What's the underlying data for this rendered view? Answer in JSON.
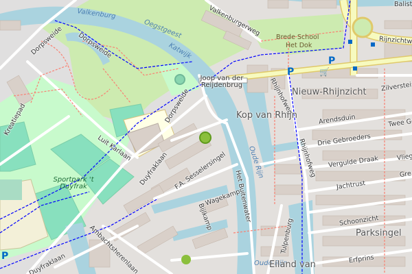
{
  "map": {
    "colors": {
      "background": "#f2efe9",
      "residential": "#e0dfdf",
      "water": "#aad3df",
      "park": "#c8facc",
      "grass": "#cdebb0",
      "pitch": "#88e0be",
      "school_area": "#ffffe5",
      "building": "#d9d0c9",
      "road_major": "#f7fabf",
      "road_minor": "#ffffff",
      "footway": "#fa8072",
      "cycleway": "#0000ff",
      "parking": "#0068c6",
      "shop": "#ac39ac"
    },
    "water_labels": [
      "Valkenburg",
      "Oegstgeest",
      "Katwijk",
      "Oude Rijn",
      "Oude Rijn"
    ],
    "street_labels": [
      "Valkenburgerweg",
      "Dorpsweide",
      "Dorpsweide",
      "Dorpsweide",
      "Luit Karlaan",
      "Duyfraklaan",
      "F.A. Sesselersingel",
      "Wagekamp",
      "Bijlkamp",
      "Het Buitenwater",
      "Ambachtsherenlaan",
      "Duyfraklaan",
      "Rhijnhofweg",
      "Rhijnhofweg",
      "Arendsduin",
      "Drie Gebroeders",
      "Vergulde Draak",
      "Jachtrust",
      "Schoonzicht",
      "Erfprins",
      "Tulpenburg",
      "Zilverstein",
      "Twee Gebroeders",
      "Vlieg",
      "Gre",
      "Rijnzichtweg",
      "Balist",
      "Kreatiepad"
    ],
    "place_labels": [
      "Nieuw-Rhijnzicht",
      "Kop van Rhijn",
      "Parksingel",
      "Eiland van"
    ],
    "park_labels": [
      "Sportpark 't Duyfrak"
    ],
    "poi_labels": {
      "bridge": "Joop van der Reijdenbrug",
      "school_line1": "Brede School",
      "school_line2": "Het Dok"
    },
    "icons": {
      "parking": "parking-icon",
      "shop": "shopping-cart-icon",
      "bus": "bus-stop-icon",
      "playground": "playground-icon"
    }
  }
}
